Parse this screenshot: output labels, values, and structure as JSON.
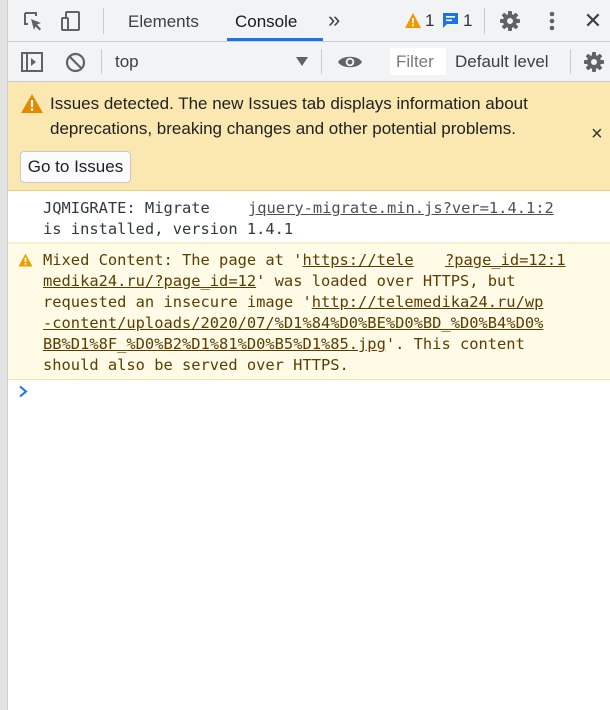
{
  "tabs": {
    "elements": "Elements",
    "console": "Console",
    "more": "»",
    "warnings_count": "1",
    "messages_count": "1"
  },
  "toolbar": {
    "context": "top",
    "filter_placeholder": "Filter",
    "level": "Default level"
  },
  "issues_banner": {
    "line1": "Issues detected. The new Issues tab displays information about",
    "line2": "deprecations, breaking changes and other potential problems.",
    "button": "Go to Issues",
    "close": "×"
  },
  "messages": [
    {
      "type": "info",
      "text1": "JQMIGRATE: Migrate",
      "source": "jquery-migrate.min.js?ver=1.4.1:2",
      "text2": "is installed, version 1.4.1"
    },
    {
      "type": "warning",
      "l1_text": "Mixed Content: The page at '",
      "l1_link": "https://tele",
      "source": "?page_id=12:1",
      "l2_link": "medika24.ru/?page_id=12",
      "l2_text": "' was loaded over HTTPS, but",
      "l3_text": "requested an insecure image '",
      "l3_link": "http://telemedika24.ru/wp",
      "l4_link": "-content/uploads/2020/07/%D1%84%D0%BE%D0%BD_%D0%B4%D0%",
      "l5_link": "BB%D1%8F_%D0%B2%D1%81%D0%B5%D1%85.jpg",
      "l5_text": "'. This content",
      "l6_text": "should also be served over HTTPS."
    }
  ],
  "colors": {
    "accent": "#1a73e8",
    "warning": "#f29900",
    "banner": "#fbe8b0",
    "warning_row": "#fffbe6"
  }
}
